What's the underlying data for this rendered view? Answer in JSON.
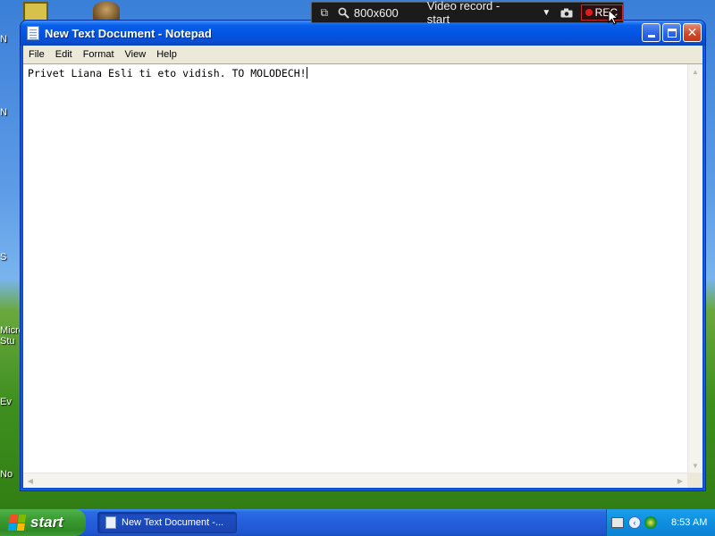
{
  "desktop": {
    "labels": [
      "N",
      "N",
      "S",
      "Micro",
      "Stu",
      "Ev",
      "No"
    ]
  },
  "recorder": {
    "resolution": "800x600",
    "mode": "Video record - start",
    "rec_label": "REC",
    "icons": [
      "restore-icon",
      "zoom-icon",
      "dropdown-icon",
      "camera-icon",
      "record-dot-icon"
    ]
  },
  "window": {
    "title": "New Text Document - Notepad",
    "buttons": [
      "minimize",
      "maximize",
      "close"
    ],
    "menu": [
      "File",
      "Edit",
      "Format",
      "View",
      "Help"
    ],
    "content": "Privet Liana Esli ti eto vidish. TO MOLODECH!"
  },
  "taskbar": {
    "start_label": "start",
    "task_label": "New Text Document -...",
    "clock": "8:53 AM",
    "colors": {
      "start_green": "#3a9a31",
      "bar_blue": "#245edb",
      "tray_blue": "#0f8ee0"
    }
  }
}
